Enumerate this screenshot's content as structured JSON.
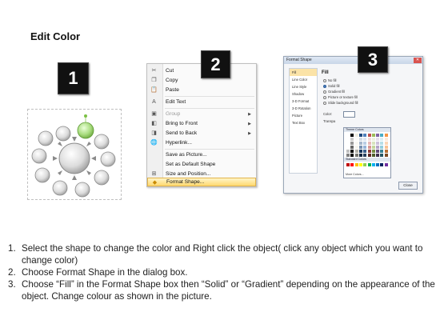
{
  "title": "Edit Color",
  "steps": [
    "1",
    "2",
    "3"
  ],
  "context_menu": {
    "items": [
      {
        "label": "Cut",
        "icon": "scissors-icon",
        "glyph": "✂",
        "disabled": false,
        "submenu": false
      },
      {
        "label": "Copy",
        "icon": "copy-icon",
        "glyph": "❐",
        "disabled": false,
        "submenu": false
      },
      {
        "label": "Paste",
        "icon": "paste-icon",
        "glyph": "📋",
        "disabled": false,
        "submenu": false
      },
      {
        "label": "Edit Text",
        "icon": "edit-text-icon",
        "glyph": "A",
        "disabled": false,
        "submenu": false
      },
      {
        "label": "Group",
        "icon": "group-icon",
        "glyph": "▣",
        "disabled": true,
        "submenu": true
      },
      {
        "label": "Bring to Front",
        "icon": "bring-front-icon",
        "glyph": "◧",
        "disabled": false,
        "submenu": true
      },
      {
        "label": "Send to Back",
        "icon": "send-back-icon",
        "glyph": "◨",
        "disabled": false,
        "submenu": true
      },
      {
        "label": "Hyperlink...",
        "icon": "hyperlink-icon",
        "glyph": "🌐",
        "disabled": false,
        "submenu": false
      },
      {
        "label": "Save as Picture...",
        "icon": "",
        "glyph": "",
        "disabled": false,
        "submenu": false
      },
      {
        "label": "Set as Default Shape",
        "icon": "",
        "glyph": "",
        "disabled": false,
        "submenu": false
      },
      {
        "label": "Size and Position...",
        "icon": "size-position-icon",
        "glyph": "⊞",
        "disabled": false,
        "submenu": false
      },
      {
        "label": "Format Shape...",
        "icon": "format-shape-icon",
        "glyph": "◆",
        "disabled": false,
        "submenu": false,
        "highlighted": true
      }
    ]
  },
  "dialog": {
    "title": "Format Shape",
    "nav": [
      "Fill",
      "Line Color",
      "Line Style",
      "Shadow",
      "3-D Format",
      "3-D Rotation",
      "Picture",
      "Text Box"
    ],
    "section": "Fill",
    "options": [
      {
        "label": "No fill",
        "selected": false
      },
      {
        "label": "Solid fill",
        "selected": true
      },
      {
        "label": "Gradient fill",
        "selected": false
      },
      {
        "label": "Picture or texture fill",
        "selected": false
      },
      {
        "label": "Slide background fill",
        "selected": false
      }
    ],
    "color_label": "Color:",
    "transparency_label": "Transpa",
    "palette": {
      "theme_header": "Theme Colors",
      "standard_header": "Standard Colors",
      "more": "More Colors...",
      "theme_top": [
        "#ffffff",
        "#000000",
        "#eeece1",
        "#1f497d",
        "#4f81bd",
        "#c0504d",
        "#9bbb59",
        "#8064a2",
        "#4bacc6",
        "#f79646"
      ],
      "standard": [
        "#c00000",
        "#ff0000",
        "#ffc000",
        "#ffff00",
        "#92d050",
        "#00b050",
        "#00b0f0",
        "#0070c0",
        "#002060",
        "#7030a0"
      ]
    },
    "close_label": "Close"
  },
  "instructions": [
    {
      "num": "1.",
      "text": "Select the shape to change the color and Right click the object( click any object which you want to change color)"
    },
    {
      "num": "2.",
      "text": "Choose Format Shape in the dialog box."
    },
    {
      "num": "3.",
      "text": "Choose “Fill” in the Format Shape box then “Solid” or “Gradient” depending on the appearance of the object. Change colour as shown in the picture."
    }
  ],
  "colors": {
    "selected_circle": "#a8dc7e",
    "circle": "#d8d8d8",
    "badge": "#111111"
  }
}
